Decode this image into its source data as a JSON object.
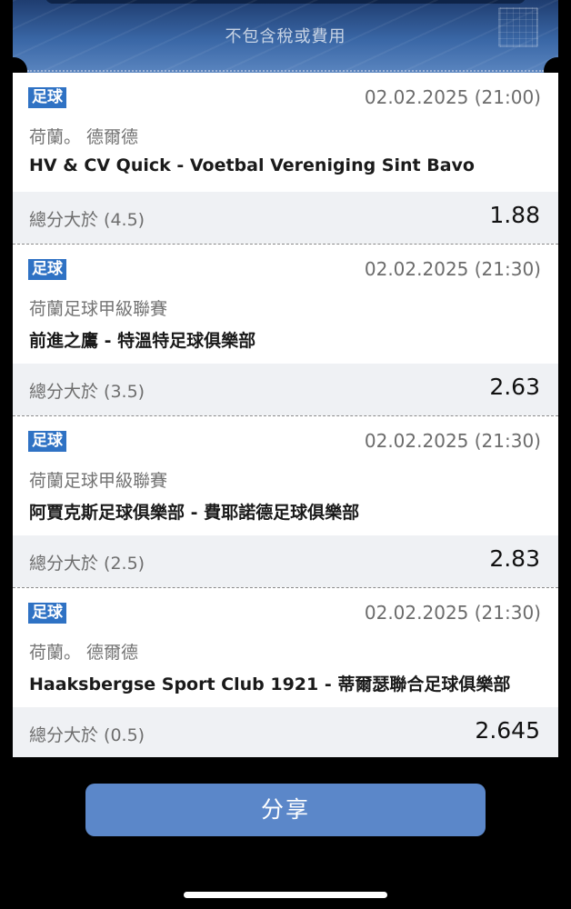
{
  "header": {
    "note": "不包含稅或費用"
  },
  "bets": [
    {
      "sport": "足球",
      "date": "02.02.2025 (21:00)",
      "league": "荷蘭。 德爾德",
      "match": "HV & CV Quick - Voetbal Vereniging Sint Bavo",
      "market": "總分大於 (4.5)",
      "odds": "1.88"
    },
    {
      "sport": "足球",
      "date": "02.02.2025 (21:30)",
      "league": "荷蘭足球甲級聯賽",
      "match": "前進之鷹 - 特溫特足球俱樂部",
      "market": "總分大於 (3.5)",
      "odds": "2.63"
    },
    {
      "sport": "足球",
      "date": "02.02.2025 (21:30)",
      "league": "荷蘭足球甲級聯賽",
      "match": "阿賈克斯足球俱樂部 - 費耶諾德足球俱樂部",
      "market": "總分大於 (2.5)",
      "odds": "2.83"
    },
    {
      "sport": "足球",
      "date": "02.02.2025 (21:30)",
      "league": "荷蘭。 德爾德",
      "match": "Haaksbergse Sport Club 1921 - 蒂爾瑟聯合足球俱樂部",
      "market": "總分大於 (0.5)",
      "odds": "2.645"
    }
  ],
  "share_button": {
    "label": "分享"
  },
  "colors": {
    "sport_tag": "#2f72c4",
    "share_button": "#5b87c9",
    "market_row_bg": "#eff1f4"
  }
}
